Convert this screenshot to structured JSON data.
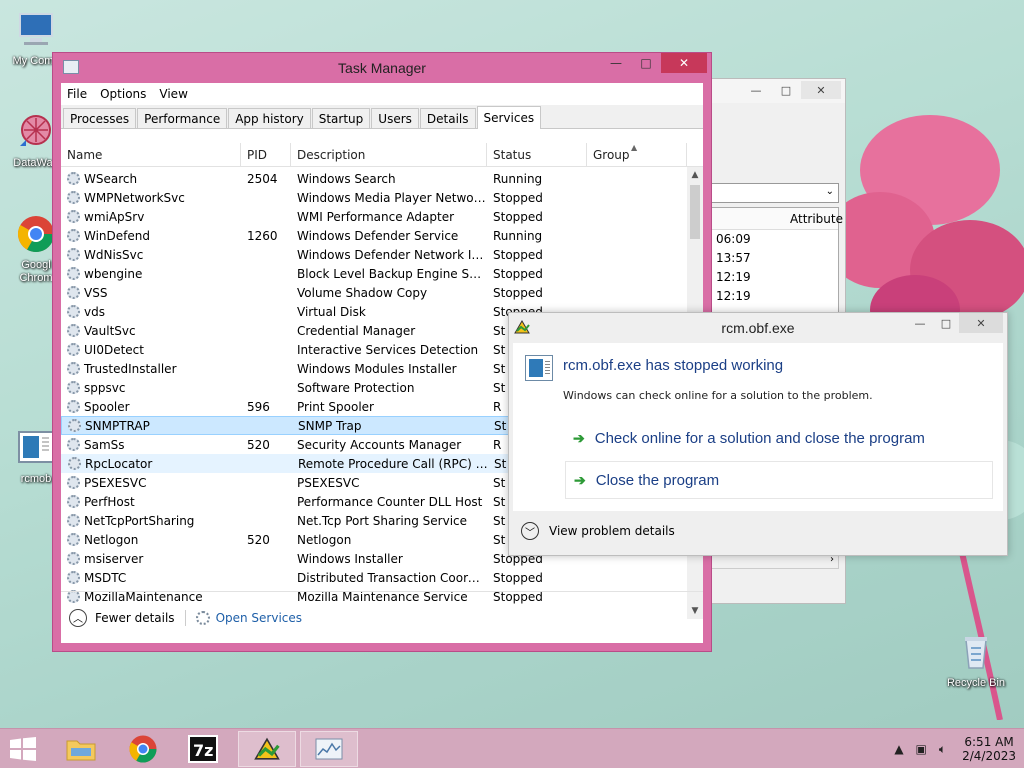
{
  "desktop": {
    "icons": [
      {
        "label": "My Comp"
      },
      {
        "label": "DataWag"
      },
      {
        "label": "Googl"
      },
      {
        "label": "Chrom"
      },
      {
        "label": "rcmob"
      },
      {
        "label": "Recycle Bin"
      }
    ]
  },
  "task_manager": {
    "title": "Task Manager",
    "menu": [
      "File",
      "Options",
      "View"
    ],
    "tabs": [
      "Processes",
      "Performance",
      "App history",
      "Startup",
      "Users",
      "Details",
      "Services"
    ],
    "active_tab": "Services",
    "columns": {
      "name": "Name",
      "pid": "PID",
      "description": "Description",
      "status": "Status",
      "group": "Group"
    },
    "rows": [
      {
        "name": "WSearch",
        "pid": "2504",
        "description": "Windows Search",
        "status": "Running"
      },
      {
        "name": "WMPNetworkSvc",
        "pid": "",
        "description": "Windows Media Player Network ...",
        "status": "Stopped"
      },
      {
        "name": "wmiApSrv",
        "pid": "",
        "description": "WMI Performance Adapter",
        "status": "Stopped"
      },
      {
        "name": "WinDefend",
        "pid": "1260",
        "description": "Windows Defender Service",
        "status": "Running"
      },
      {
        "name": "WdNisSvc",
        "pid": "",
        "description": "Windows Defender Network Insp...",
        "status": "Stopped"
      },
      {
        "name": "wbengine",
        "pid": "",
        "description": "Block Level Backup Engine Service",
        "status": "Stopped"
      },
      {
        "name": "VSS",
        "pid": "",
        "description": "Volume Shadow Copy",
        "status": "Stopped"
      },
      {
        "name": "vds",
        "pid": "",
        "description": "Virtual Disk",
        "status": "Stopped"
      },
      {
        "name": "VaultSvc",
        "pid": "",
        "description": "Credential Manager",
        "status": "St"
      },
      {
        "name": "UI0Detect",
        "pid": "",
        "description": "Interactive Services Detection",
        "status": "St"
      },
      {
        "name": "TrustedInstaller",
        "pid": "",
        "description": "Windows Modules Installer",
        "status": "St"
      },
      {
        "name": "sppsvc",
        "pid": "",
        "description": "Software Protection",
        "status": "St"
      },
      {
        "name": "Spooler",
        "pid": "596",
        "description": "Print Spooler",
        "status": "R"
      },
      {
        "name": "SNMPTRAP",
        "pid": "",
        "description": "SNMP Trap",
        "status": "St"
      },
      {
        "name": "SamSs",
        "pid": "520",
        "description": "Security Accounts Manager",
        "status": "R"
      },
      {
        "name": "RpcLocator",
        "pid": "",
        "description": "Remote Procedure Call (RPC) Lo...",
        "status": "St"
      },
      {
        "name": "PSEXESVC",
        "pid": "",
        "description": "PSEXESVC",
        "status": "St"
      },
      {
        "name": "PerfHost",
        "pid": "",
        "description": "Performance Counter DLL Host",
        "status": "St"
      },
      {
        "name": "NetTcpPortSharing",
        "pid": "",
        "description": "Net.Tcp Port Sharing Service",
        "status": "St"
      },
      {
        "name": "Netlogon",
        "pid": "520",
        "description": "Netlogon",
        "status": "St"
      },
      {
        "name": "msiserver",
        "pid": "",
        "description": "Windows Installer",
        "status": "Stopped"
      },
      {
        "name": "MSDTC",
        "pid": "",
        "description": "Distributed Transaction Coordin...",
        "status": "Stopped"
      },
      {
        "name": "MozillaMaintenance",
        "pid": "",
        "description": "Mozilla Maintenance Service",
        "status": "Stopped"
      }
    ],
    "footer": {
      "fewer_details": "Fewer details",
      "open_services": "Open Services"
    }
  },
  "background_window": {
    "column": "Attribute",
    "times": [
      "06:09",
      "13:57",
      "12:19",
      "12:19"
    ]
  },
  "error_dialog": {
    "title": "rcm.obf.exe",
    "heading": "rcm.obf.exe has stopped working",
    "message": "Windows can check online for a solution to the problem.",
    "option_check": "Check online for a solution and close the program",
    "option_close": "Close the program",
    "details": "View problem details"
  },
  "taskbar": {
    "time": "6:51 AM",
    "date": "2/4/2023"
  },
  "colors": {
    "task_manager_frame": "#d96ea6",
    "taskbar": "#d3a8bd",
    "link": "#1e5fa8",
    "dialog_heading": "#1b3f86"
  }
}
